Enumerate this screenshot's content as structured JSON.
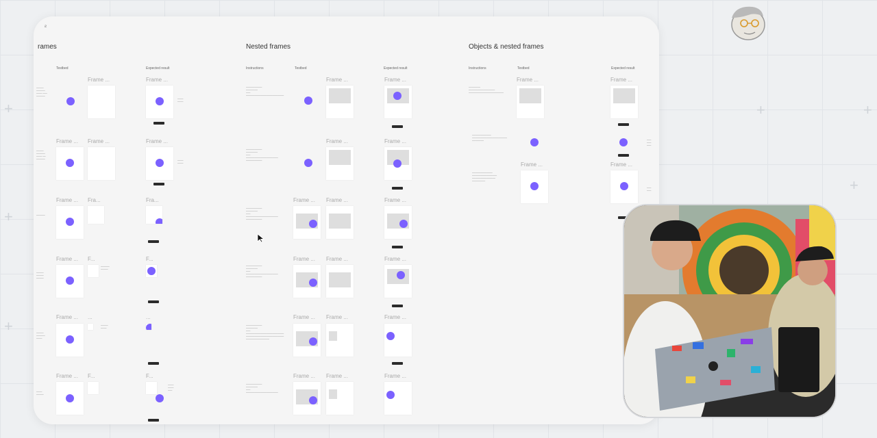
{
  "sections": [
    {
      "title": "rames",
      "columns": [
        "Testbed",
        "Expected result"
      ]
    },
    {
      "title": "Nested frames",
      "columns": [
        "Instructions",
        "Testbed",
        "Expected result"
      ]
    },
    {
      "title": "Objects & nested frames",
      "columns": [
        "Instructions",
        "Testbed",
        "Expected result"
      ]
    }
  ],
  "frame_labels": {
    "full": "Frame ...",
    "short": "Fra...",
    "f_dots": "F...",
    "f": "F...",
    "dots": "..."
  },
  "colors": {
    "accent": "#7b61ff",
    "frame_bg": "#ffffff",
    "placeholder": "#dedede",
    "canvas_bg": "#f5f5f5"
  },
  "icons": {
    "cursor": "cursor-arrow-icon",
    "avatar": "avatar-sketch-icon"
  },
  "webcam": {
    "caption": ""
  }
}
